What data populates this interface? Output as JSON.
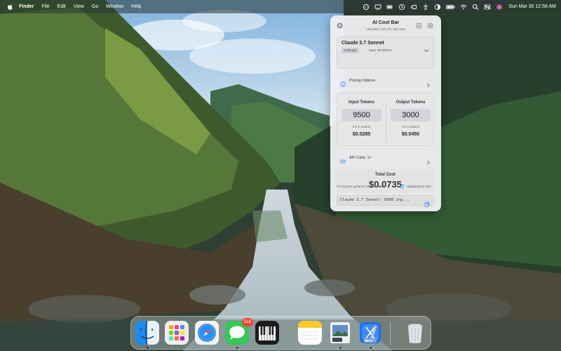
{
  "menubar": {
    "app_name": "Finder",
    "menus": [
      "File",
      "Edit",
      "View",
      "Go",
      "Window",
      "Help"
    ],
    "clock": "Sun Mar 30  12:58 AM",
    "icons": [
      "ai-cost-bar-icon",
      "display-icon",
      "battery-status-icon",
      "clock-icon",
      "stage-manager-icon",
      "accessibility-icon",
      "control-toggle-icon",
      "battery-icon",
      "wifi-icon",
      "search-icon",
      "control-center-icon",
      "siri-icon"
    ]
  },
  "popover": {
    "title": "AI Cost Bar",
    "subtitle": "calculate LLM API call costs",
    "model": {
      "name": "Claude 3.7 Sonnet",
      "provider": "Anthropic",
      "pricing": "input: $0.003/1K"
    },
    "pricing_options_label": "Pricing Options",
    "input": {
      "label": "Input Tokens",
      "value": "9500",
      "k_tokens": "9.5 K tokens",
      "cost": "$0.0285"
    },
    "output": {
      "label": "Output Tokens",
      "value": "3000",
      "k_tokens": "3.0 K tokens",
      "cost": "$0.0450"
    },
    "api_calls_label": "API Calls: 1×",
    "total": {
      "label": "Total Cost",
      "value": "$0.0735"
    },
    "last_updated": "Pricing last updated: Mar 29, 2025",
    "updated_status": "Updated just now",
    "summary": "Claude 3.7 Sonnet: 9500 inp..."
  },
  "dock": {
    "apps": [
      {
        "name": "Finder",
        "icon": "finder-icon"
      },
      {
        "name": "Launchpad",
        "icon": "launchpad-icon"
      },
      {
        "name": "Safari",
        "icon": "safari-icon"
      },
      {
        "name": "Messages",
        "icon": "messages-icon",
        "badge": "118"
      },
      {
        "name": "Piano",
        "icon": "piano-icon"
      },
      {
        "name": "Notes",
        "icon": "notes-icon"
      },
      {
        "name": "Preview",
        "icon": "preview-icon"
      },
      {
        "name": "Xcode",
        "icon": "xcode-icon",
        "label": "BETA"
      },
      {
        "name": "Trash",
        "icon": "trash-icon"
      }
    ]
  },
  "colors": {
    "accent": "#3b82f6",
    "badge": "#f0443a",
    "popover_bg": "#eeeef0"
  }
}
